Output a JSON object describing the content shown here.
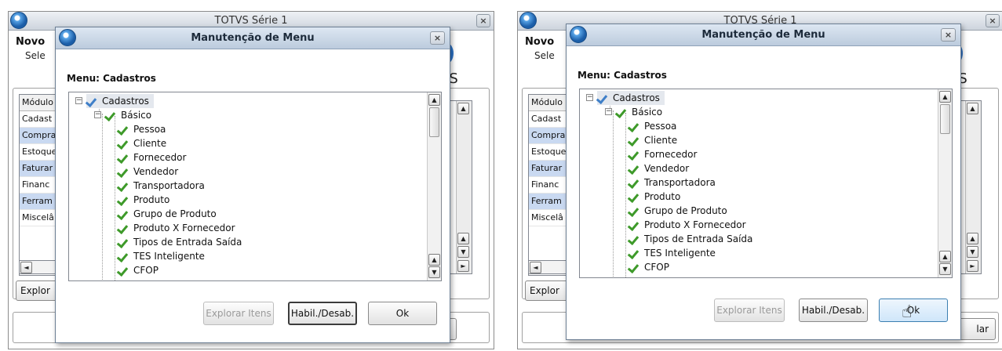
{
  "background_window": {
    "title": "TOTVS Série 1",
    "close_glyph": "×",
    "novo_label": "Novo",
    "sele_label": "Sele",
    "vs_text": "VS",
    "modules": [
      "Módulo",
      "Cadast",
      "Compra",
      "Estoque",
      "Faturar",
      "Financ",
      "Ferram",
      "Miscelâ"
    ],
    "explorar_label": "Explor",
    "bottom_button_label": "lar"
  },
  "dialog": {
    "title": "Manutenção de Menu",
    "close_glyph": "×",
    "menu_label": "Menu: Cadastros",
    "tree_root": "Cadastros",
    "tree_group": "Básico",
    "tree_items": [
      "Pessoa",
      "Cliente",
      "Fornecedor",
      "Vendedor",
      "Transportadora",
      "Produto",
      "Grupo de Produto",
      "Produto X Fornecedor",
      "Tipos de Entrada Saída",
      "TES Inteligente",
      "CFOP"
    ],
    "buttons": {
      "explorar_itens": "Explorar Itens",
      "habil_desab": "Habil./Desab.",
      "ok": "Ok"
    }
  },
  "icons": {
    "app": "totvs-app-icon",
    "check": "green-check-icon",
    "expand": "minus-box-icon",
    "scroll_up": "▲",
    "scroll_down": "▼",
    "scroll_left": "◄",
    "scroll_right": "►",
    "cursor": "hand-pointer-icon"
  },
  "colors": {
    "check_green": "#3e9a2a",
    "check_blue": "#3f7fc8",
    "selection": "#c9d9f1"
  }
}
